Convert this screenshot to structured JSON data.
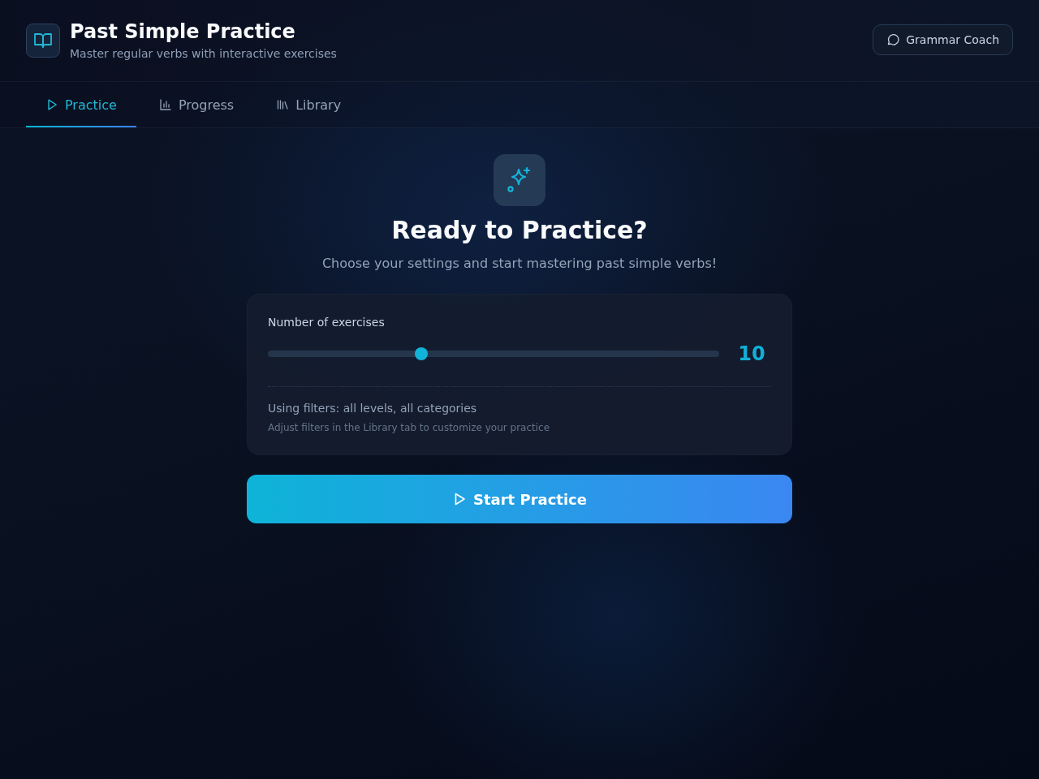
{
  "header": {
    "title": "Past Simple Practice",
    "subtitle": "Master regular verbs with interactive exercises",
    "coach_button": "Grammar Coach"
  },
  "tabs": [
    {
      "label": "Practice",
      "selected": true
    },
    {
      "label": "Progress",
      "selected": false
    },
    {
      "label": "Library",
      "selected": false
    }
  ],
  "hero": {
    "title": "Ready to Practice?",
    "subtitle": "Choose your settings and start mastering past simple verbs!"
  },
  "settings": {
    "slider_label": "Number of exercises",
    "level": 0.34,
    "reading": "10",
    "filters": "Using filters: all levels, all categories",
    "hint": "Adjust filters in the Library tab to customize your practice"
  },
  "start_button": "Start Practice"
}
